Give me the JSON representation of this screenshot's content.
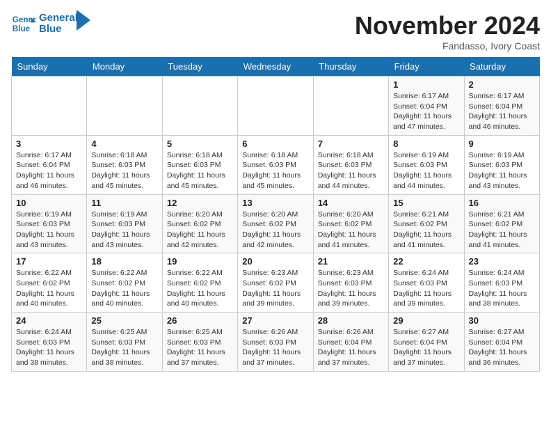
{
  "header": {
    "logo_line1": "General",
    "logo_line2": "Blue",
    "month": "November 2024",
    "location": "Fandasso, Ivory Coast"
  },
  "days_of_week": [
    "Sunday",
    "Monday",
    "Tuesday",
    "Wednesday",
    "Thursday",
    "Friday",
    "Saturday"
  ],
  "weeks": [
    [
      {
        "day": "",
        "info": ""
      },
      {
        "day": "",
        "info": ""
      },
      {
        "day": "",
        "info": ""
      },
      {
        "day": "",
        "info": ""
      },
      {
        "day": "",
        "info": ""
      },
      {
        "day": "1",
        "info": "Sunrise: 6:17 AM\nSunset: 6:04 PM\nDaylight: 11 hours and 47 minutes."
      },
      {
        "day": "2",
        "info": "Sunrise: 6:17 AM\nSunset: 6:04 PM\nDaylight: 11 hours and 46 minutes."
      }
    ],
    [
      {
        "day": "3",
        "info": "Sunrise: 6:17 AM\nSunset: 6:04 PM\nDaylight: 11 hours and 46 minutes."
      },
      {
        "day": "4",
        "info": "Sunrise: 6:18 AM\nSunset: 6:03 PM\nDaylight: 11 hours and 45 minutes."
      },
      {
        "day": "5",
        "info": "Sunrise: 6:18 AM\nSunset: 6:03 PM\nDaylight: 11 hours and 45 minutes."
      },
      {
        "day": "6",
        "info": "Sunrise: 6:18 AM\nSunset: 6:03 PM\nDaylight: 11 hours and 45 minutes."
      },
      {
        "day": "7",
        "info": "Sunrise: 6:18 AM\nSunset: 6:03 PM\nDaylight: 11 hours and 44 minutes."
      },
      {
        "day": "8",
        "info": "Sunrise: 6:19 AM\nSunset: 6:03 PM\nDaylight: 11 hours and 44 minutes."
      },
      {
        "day": "9",
        "info": "Sunrise: 6:19 AM\nSunset: 6:03 PM\nDaylight: 11 hours and 43 minutes."
      }
    ],
    [
      {
        "day": "10",
        "info": "Sunrise: 6:19 AM\nSunset: 6:03 PM\nDaylight: 11 hours and 43 minutes."
      },
      {
        "day": "11",
        "info": "Sunrise: 6:19 AM\nSunset: 6:03 PM\nDaylight: 11 hours and 43 minutes."
      },
      {
        "day": "12",
        "info": "Sunrise: 6:20 AM\nSunset: 6:02 PM\nDaylight: 11 hours and 42 minutes."
      },
      {
        "day": "13",
        "info": "Sunrise: 6:20 AM\nSunset: 6:02 PM\nDaylight: 11 hours and 42 minutes."
      },
      {
        "day": "14",
        "info": "Sunrise: 6:20 AM\nSunset: 6:02 PM\nDaylight: 11 hours and 41 minutes."
      },
      {
        "day": "15",
        "info": "Sunrise: 6:21 AM\nSunset: 6:02 PM\nDaylight: 11 hours and 41 minutes."
      },
      {
        "day": "16",
        "info": "Sunrise: 6:21 AM\nSunset: 6:02 PM\nDaylight: 11 hours and 41 minutes."
      }
    ],
    [
      {
        "day": "17",
        "info": "Sunrise: 6:22 AM\nSunset: 6:02 PM\nDaylight: 11 hours and 40 minutes."
      },
      {
        "day": "18",
        "info": "Sunrise: 6:22 AM\nSunset: 6:02 PM\nDaylight: 11 hours and 40 minutes."
      },
      {
        "day": "19",
        "info": "Sunrise: 6:22 AM\nSunset: 6:02 PM\nDaylight: 11 hours and 40 minutes."
      },
      {
        "day": "20",
        "info": "Sunrise: 6:23 AM\nSunset: 6:02 PM\nDaylight: 11 hours and 39 minutes."
      },
      {
        "day": "21",
        "info": "Sunrise: 6:23 AM\nSunset: 6:03 PM\nDaylight: 11 hours and 39 minutes."
      },
      {
        "day": "22",
        "info": "Sunrise: 6:24 AM\nSunset: 6:03 PM\nDaylight: 11 hours and 39 minutes."
      },
      {
        "day": "23",
        "info": "Sunrise: 6:24 AM\nSunset: 6:03 PM\nDaylight: 11 hours and 38 minutes."
      }
    ],
    [
      {
        "day": "24",
        "info": "Sunrise: 6:24 AM\nSunset: 6:03 PM\nDaylight: 11 hours and 38 minutes."
      },
      {
        "day": "25",
        "info": "Sunrise: 6:25 AM\nSunset: 6:03 PM\nDaylight: 11 hours and 38 minutes."
      },
      {
        "day": "26",
        "info": "Sunrise: 6:25 AM\nSunset: 6:03 PM\nDaylight: 11 hours and 37 minutes."
      },
      {
        "day": "27",
        "info": "Sunrise: 6:26 AM\nSunset: 6:03 PM\nDaylight: 11 hours and 37 minutes."
      },
      {
        "day": "28",
        "info": "Sunrise: 6:26 AM\nSunset: 6:04 PM\nDaylight: 11 hours and 37 minutes."
      },
      {
        "day": "29",
        "info": "Sunrise: 6:27 AM\nSunset: 6:04 PM\nDaylight: 11 hours and 37 minutes."
      },
      {
        "day": "30",
        "info": "Sunrise: 6:27 AM\nSunset: 6:04 PM\nDaylight: 11 hours and 36 minutes."
      }
    ]
  ]
}
